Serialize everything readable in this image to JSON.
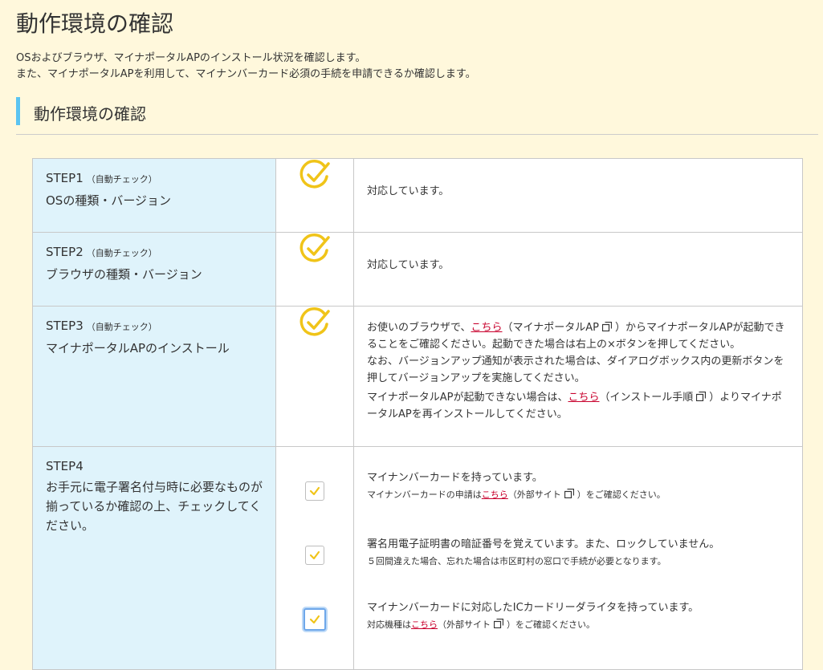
{
  "page": {
    "title": "動作環境の確認",
    "intro_line1": "OSおよびブラウザ、マイナポータルAPのインストール状況を確認します。",
    "intro_line2": "また、マイナポータルAPを利用して、マイナンバーカード必須の手続を申請できるか確認します。"
  },
  "section": {
    "title": "動作環境の確認"
  },
  "colors": {
    "accent_bar": "#5bc4f1",
    "label_bg": "#dff3fb",
    "page_bg": "#fff8dc",
    "ok": "#f0c419",
    "link": "#c8002c"
  },
  "steps": [
    {
      "name": "STEP1",
      "auto": "（自動チェック）",
      "sub": "OSの種類・バージョン",
      "status_icon": "check-circle-icon",
      "status": "ok",
      "desc": "対応しています。"
    },
    {
      "name": "STEP2",
      "auto": "（自動チェック）",
      "sub": "ブラウザの種類・バージョン",
      "status_icon": "check-circle-icon",
      "status": "ok",
      "desc": "対応しています。"
    },
    {
      "name": "STEP3",
      "auto": "（自動チェック）",
      "sub": "マイナポータルAPのインストール",
      "status_icon": "check-circle-icon",
      "status": "ok",
      "p1_pre": "お使いのブラウザで、",
      "p1_link": "こちら",
      "p1_paren": "（マイナポータルAP",
      "p1_post": "）からマイナポータルAPが起動できることをご確認ください。起動できた場合は右上の×ボタンを押してください。",
      "p2": "なお、バージョンアップ通知が表示された場合は、ダイアログボックス内の更新ボタンを押してバージョンアップを実施してください。",
      "p3_pre": "マイナポータルAPが起動できない場合は、",
      "p3_link": "こちら",
      "p3_paren": "（インストール手順",
      "p3_post": "）よりマイナポータルAPを再インストールしてください。"
    },
    {
      "name": "STEP4",
      "sub": "お手元に電子署名付与時に必要なものが揃っているか確認の上、チェックしてください。",
      "checks": [
        {
          "checked": true,
          "text": "マイナンバーカードを持っています。",
          "note_pre": "マイナンバーカードの申請は",
          "note_link": "こちら",
          "note_paren": "（外部サイト",
          "note_post": "）をご確認ください。"
        },
        {
          "checked": true,
          "text": "署名用電子証明書の暗証番号を覚えています。また、ロックしていません。",
          "note": "５回間違えた場合、忘れた場合は市区町村の窓口で手続が必要となります。"
        },
        {
          "checked": true,
          "focused": true,
          "text": "マイナンバーカードに対応したICカードリーダライタを持っています。",
          "note_pre": "対応機種は",
          "note_link": "こちら",
          "note_paren": "（外部サイト",
          "note_post": "）をご確認ください。"
        }
      ]
    }
  ]
}
